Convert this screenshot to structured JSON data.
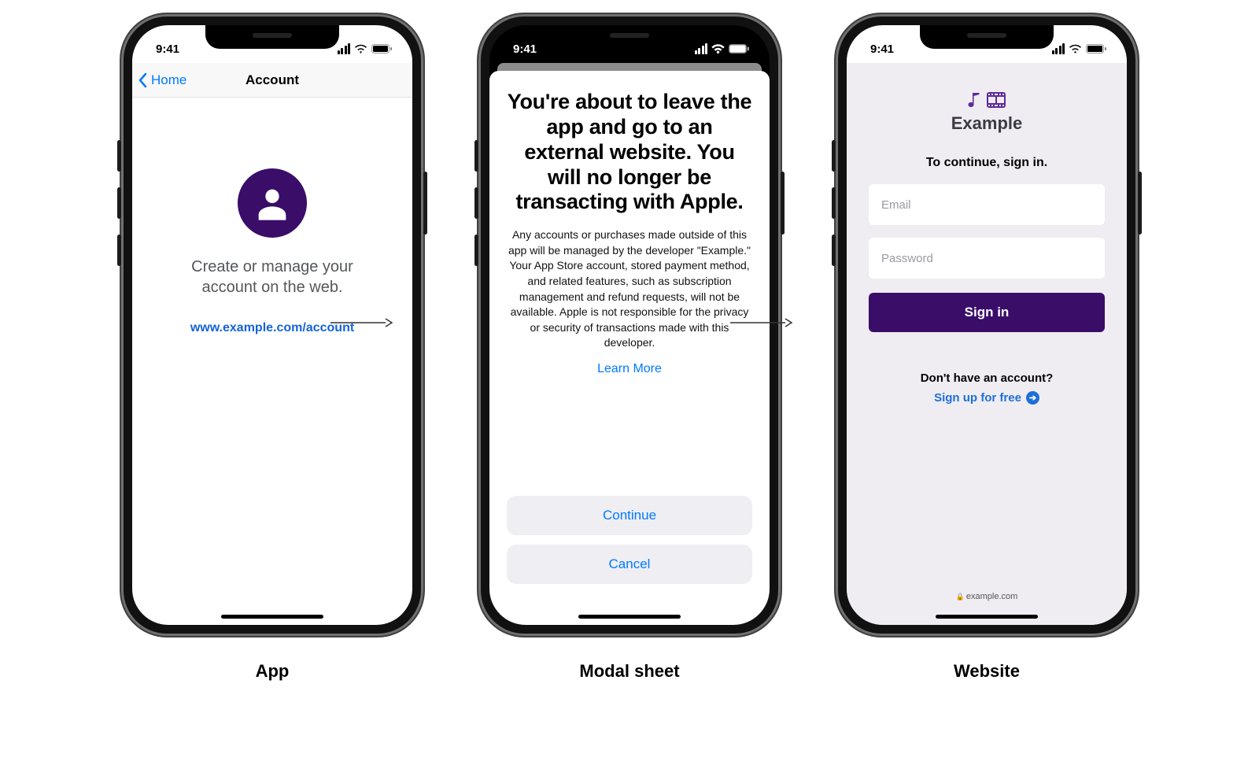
{
  "status": {
    "time": "9:41"
  },
  "captions": {
    "app": "App",
    "modal": "Modal sheet",
    "website": "Website"
  },
  "app": {
    "back_label": "Home",
    "title": "Account",
    "message": "Create or manage your account on the web.",
    "link": "www.example.com/account"
  },
  "modal": {
    "title": "You're about to leave the app and go to an external website. You will no longer be transacting with Apple.",
    "body": "Any accounts or purchases made outside of this app will be managed by the developer \"Example.\" Your App Store account, stored payment method, and related features, such as subscription management and refund requests, will not be available. Apple is not responsible for the privacy or security of transactions made with this developer.",
    "learn_more": "Learn More",
    "continue": "Continue",
    "cancel": "Cancel"
  },
  "website": {
    "brand": "Example",
    "prompt": "To continue, sign in.",
    "email_placeholder": "Email",
    "password_placeholder": "Password",
    "signin": "Sign in",
    "noacct": "Don't have an account?",
    "signup": "Sign up for free",
    "footer_domain": "example.com"
  }
}
